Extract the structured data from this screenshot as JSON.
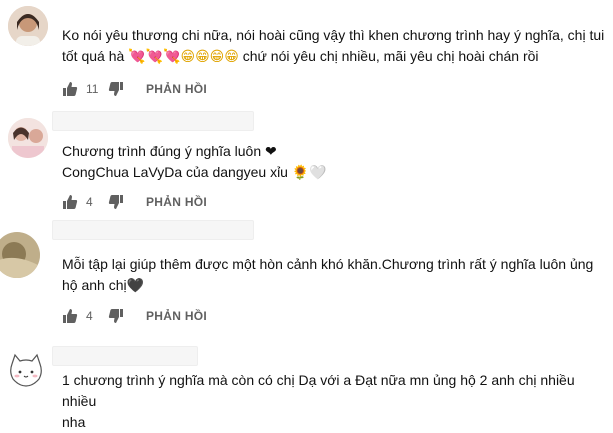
{
  "comments": [
    {
      "text_line1": "Ko nói yêu thương chi nữa, nói hoài cũng vậy thì khen chương trình hay ý nghĩa, chị tui",
      "text_line2_prefix": "tốt quá hà ",
      "text_line2_hearts": "💘💘💘",
      "text_line2_smiles": "😁😁😁😁",
      "text_line2_suffix": " chứ nói yêu chị nhiều, mãi yêu chị hoài chán rồi",
      "likes": "11",
      "reply_label": "PHẢN HỒI"
    },
    {
      "text_line1": "Chương trình đúng ý nghĩa luôn ❤",
      "text_line2": "CongChua LaVyDa của dangyeu xỉu 🌻🤍",
      "likes": "4",
      "reply_label": "PHẢN HỒI"
    },
    {
      "text_line1": "Mỗi tập lại giúp thêm được một hòn cảnh khó khăn.Chương trình rất ý nghĩa luôn ủng",
      "text_line2": "hộ anh chị🖤",
      "likes": "4",
      "reply_label": "PHẢN HỒI"
    },
    {
      "text_line1": "1 chương trình ý nghĩa mà còn có chị Dạ với a Đạt nữa mn ủng hộ 2 anh chị nhiều nhiều",
      "text_line2": "nha"
    }
  ],
  "colors": {
    "text": "#111111",
    "meta": "#606060",
    "heart": "#d6204c"
  },
  "icons": [
    "like-icon",
    "dislike-icon"
  ]
}
